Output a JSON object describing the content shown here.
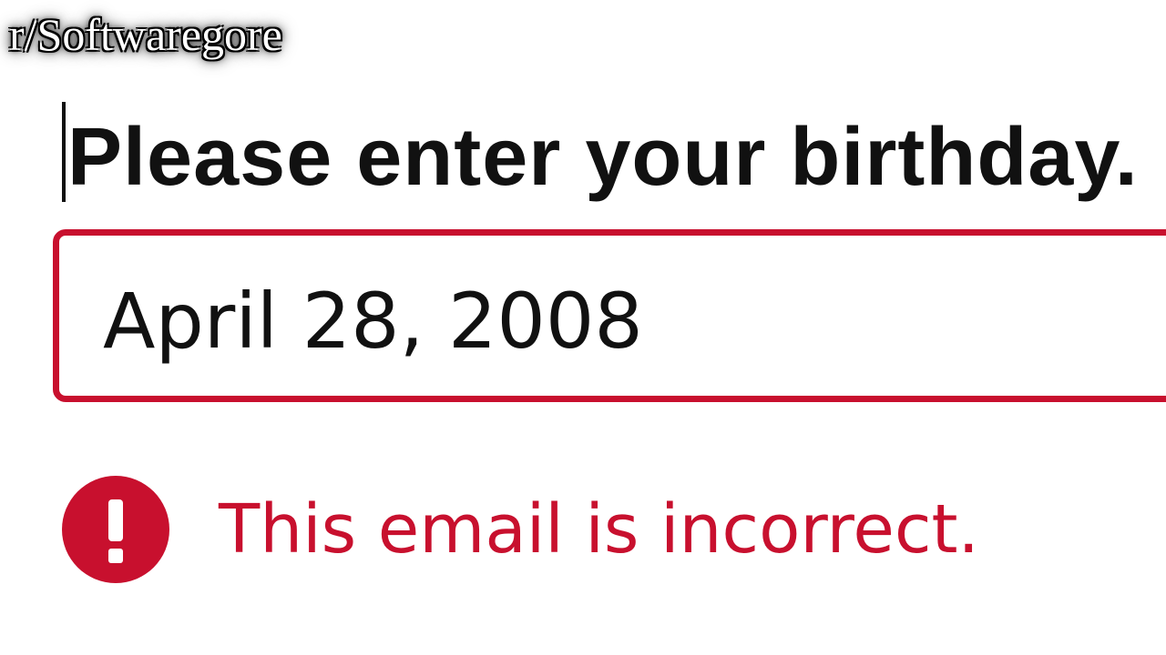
{
  "watermark": "r/Softwaregore",
  "form": {
    "heading": "Please enter your birthday.",
    "birthday_value": "April 28, 2008",
    "error_message": "This email is incorrect."
  },
  "icons": {
    "error": "exclamation-circle-icon"
  },
  "colors": {
    "error": "#c8102e",
    "text": "#111111",
    "background": "#ffffff"
  }
}
